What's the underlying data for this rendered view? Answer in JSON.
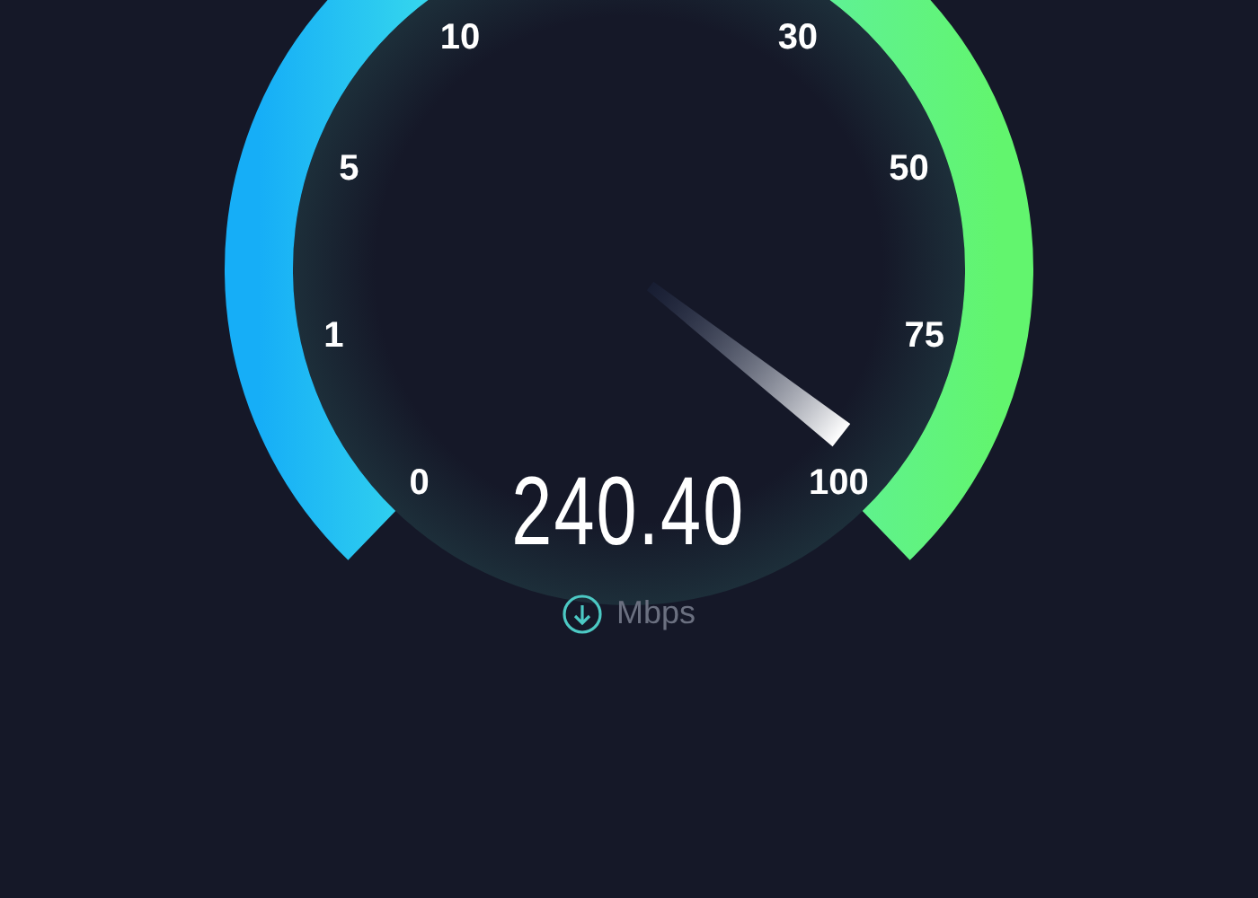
{
  "gauge": {
    "ticks": [
      "0",
      "1",
      "5",
      "10",
      "30",
      "50",
      "75",
      "100"
    ]
  },
  "reading": {
    "value": "240.40",
    "unit": "Mbps"
  }
}
